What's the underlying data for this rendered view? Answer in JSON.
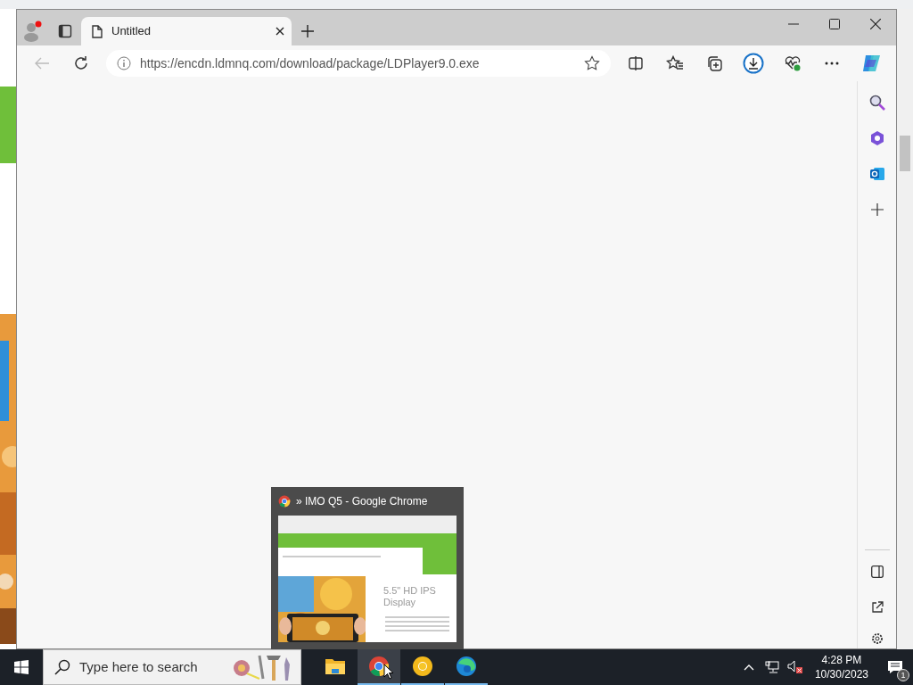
{
  "browser": {
    "tabs": [
      {
        "title": "Untitled",
        "selected": true
      }
    ],
    "address": "https://encdn.ldmnq.com/download/package/LDPlayer9.0.exe",
    "profile_notification": true
  },
  "thumbnail": {
    "title": "» IMO Q5 - Google Chrome",
    "preview_heading": "5.5\" HD IPS Display"
  },
  "taskbar": {
    "search_placeholder": "Type here to search",
    "apps": [
      {
        "kind": "explorer",
        "running": false,
        "selected": false
      },
      {
        "kind": "chrome",
        "running": true,
        "selected": true
      },
      {
        "kind": "canary",
        "running": true,
        "selected": false
      },
      {
        "kind": "edge",
        "running": true,
        "selected": false
      }
    ],
    "time": "4:28 PM",
    "date": "10/30/2023",
    "notification_count": "1"
  }
}
